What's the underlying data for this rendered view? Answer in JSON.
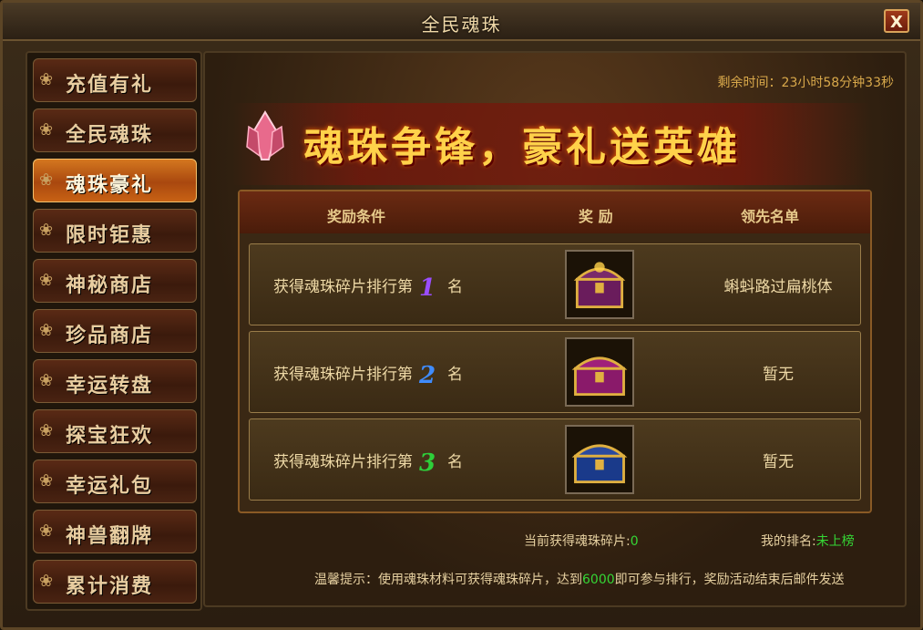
{
  "window": {
    "title": "全民魂珠",
    "close_label": "X"
  },
  "sidebar": {
    "items": [
      {
        "label": "充值有礼",
        "active": false
      },
      {
        "label": "全民魂珠",
        "active": false
      },
      {
        "label": "魂珠豪礼",
        "active": true
      },
      {
        "label": "限时钜惠",
        "active": false
      },
      {
        "label": "神秘商店",
        "active": false
      },
      {
        "label": "珍品商店",
        "active": false
      },
      {
        "label": "幸运转盘",
        "active": false
      },
      {
        "label": "探宝狂欢",
        "active": false
      },
      {
        "label": "幸运礼包",
        "active": false
      },
      {
        "label": "神兽翻牌",
        "active": false
      },
      {
        "label": "累计消费",
        "active": false
      }
    ]
  },
  "main": {
    "timer_label": "剩余时间：",
    "timer_value": "23小时58分钟33秒",
    "banner_text": "魂珠争锋，豪礼送英雄",
    "table": {
      "headers": [
        "奖励条件",
        "奖 励",
        "领先名单"
      ],
      "rows": [
        {
          "condition_prefix": "获得魂珠碎片排行第",
          "rank": "1",
          "condition_suffix": "名",
          "reward_icon": "gold-treasure-chest",
          "leader": "蝌蚪路过扁桃体",
          "rank_color": "#9a4dff"
        },
        {
          "condition_prefix": "获得魂珠碎片排行第",
          "rank": "2",
          "condition_suffix": "名",
          "reward_icon": "purple-treasure-chest",
          "leader": "暂无",
          "rank_color": "#3f8cff"
        },
        {
          "condition_prefix": "获得魂珠碎片排行第",
          "rank": "3",
          "condition_suffix": "名",
          "reward_icon": "blue-treasure-chest",
          "leader": "暂无",
          "rank_color": "#2ecf3a"
        }
      ]
    },
    "shards_label": "当前获得魂珠碎片:",
    "shards_value": "0",
    "myrank_label": "我的排名:",
    "myrank_value": "未上榜",
    "tip_prefix": "温馨提示：使用魂珠材料可获得魂珠碎片，达到",
    "tip_value": "6000",
    "tip_suffix": "即可参与排行，奖励活动结束后邮件发送"
  }
}
